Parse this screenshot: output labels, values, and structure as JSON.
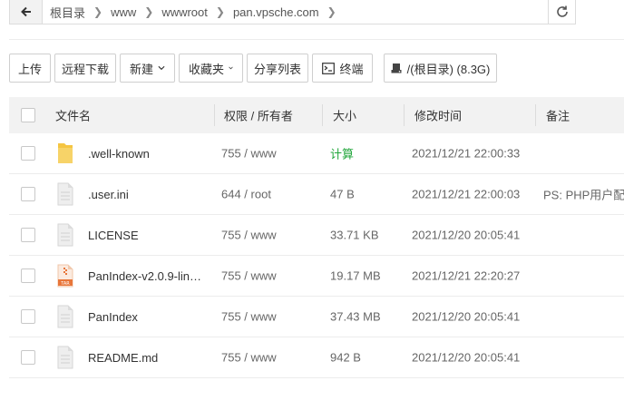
{
  "path": {
    "crumbs": [
      "根目录",
      "www",
      "wwwroot",
      "pan.vpsche.com"
    ]
  },
  "toolbar": {
    "upload": "上传",
    "remote_download": "远程下载",
    "new": "新建",
    "favorites": "收藏夹",
    "share_list": "分享列表",
    "terminal": "终端",
    "disk": "/(根目录) (8.3G)"
  },
  "table": {
    "headers": {
      "name": "文件名",
      "perm": "权限 / 所有者",
      "size": "大小",
      "mtime": "修改时间",
      "note": "备注"
    },
    "rows": [
      {
        "name": ".well-known",
        "icon": "folder-icon",
        "perm": "755 / www",
        "size": "计算",
        "mtime": "2021/12/21 22:00:33",
        "note": ""
      },
      {
        "name": ".user.ini",
        "icon": "file-icon",
        "perm": "644 / root",
        "size": "47 B",
        "mtime": "2021/12/21 22:00:03",
        "note": "PS: PHP用户配置"
      },
      {
        "name": "LICENSE",
        "icon": "file-icon",
        "perm": "755 / www",
        "size": "33.71 KB",
        "mtime": "2021/12/20 20:05:41",
        "note": ""
      },
      {
        "name": "PanIndex-v2.0.9-linu...",
        "icon": "tar-file-icon",
        "perm": "755 / www",
        "size": "19.17 MB",
        "mtime": "2021/12/21 22:20:27",
        "note": ""
      },
      {
        "name": "PanIndex",
        "icon": "file-icon",
        "perm": "755 / www",
        "size": "37.43 MB",
        "mtime": "2021/12/20 20:05:41",
        "note": ""
      },
      {
        "name": "README.md",
        "icon": "file-icon",
        "perm": "755 / www",
        "size": "942 B",
        "mtime": "2021/12/20 20:05:41",
        "note": ""
      }
    ]
  },
  "colors": {
    "calc_green": "#20a53a",
    "folder_yellow": "#f5c542",
    "tar_orange": "#e8763a"
  }
}
